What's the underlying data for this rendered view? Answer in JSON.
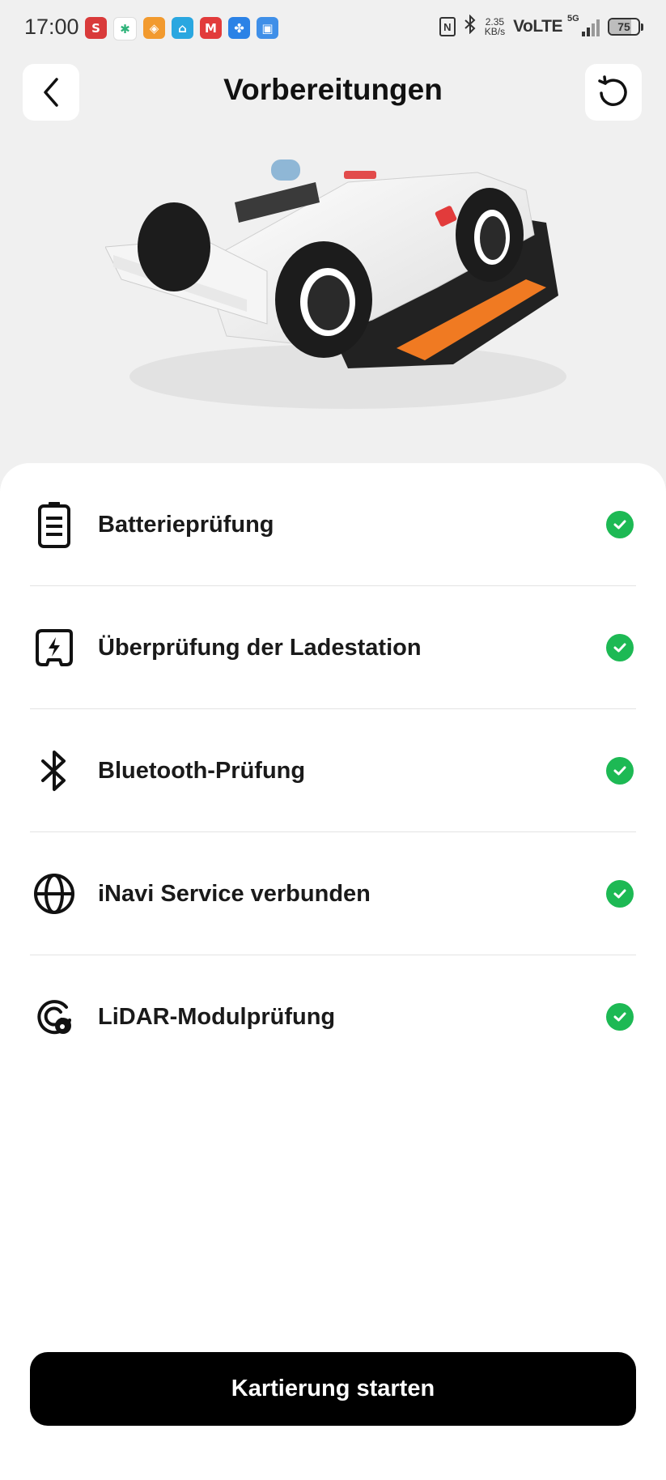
{
  "status_bar": {
    "time": "17:00",
    "app_icons": [
      {
        "name": "s-app-icon",
        "glyph": "S",
        "color": "#d93a3a"
      },
      {
        "name": "slack-icon",
        "glyph": "✱",
        "color": "#ffffff"
      },
      {
        "name": "orange-app-icon",
        "glyph": "◈",
        "color": "#f29a2e"
      },
      {
        "name": "home-app-icon",
        "glyph": "⌂",
        "color": "#2aa7e0"
      },
      {
        "name": "mammotion-app-icon",
        "glyph": "M",
        "color": "#e23b3b"
      },
      {
        "name": "fan-app-icon",
        "glyph": "✤",
        "color": "#2b82e6"
      },
      {
        "name": "blue-app-icon",
        "glyph": "▣",
        "color": "#3f8fe8"
      }
    ],
    "net_speed_value": "2.35",
    "net_speed_unit": "KB/s",
    "network_label": "VoLTE",
    "network_gen": "5G",
    "battery_level": "75"
  },
  "header": {
    "title": "Vorbereitungen"
  },
  "checks": [
    {
      "label": "Batterieprüfung",
      "icon": "battery-icon",
      "status": "passed"
    },
    {
      "label": "Überprüfung der Ladestation",
      "icon": "charging-station-icon",
      "status": "passed"
    },
    {
      "label": "Bluetooth-Prüfung",
      "icon": "bluetooth-icon",
      "status": "passed"
    },
    {
      "label": "iNavi Service verbunden",
      "icon": "globe-icon",
      "status": "passed"
    },
    {
      "label": "LiDAR-Modulprüfung",
      "icon": "lidar-icon",
      "status": "passed"
    }
  ],
  "colors": {
    "accent_check": "#1db954",
    "primary_button": "#000000"
  },
  "footer": {
    "start_button_label": "Kartierung starten"
  }
}
